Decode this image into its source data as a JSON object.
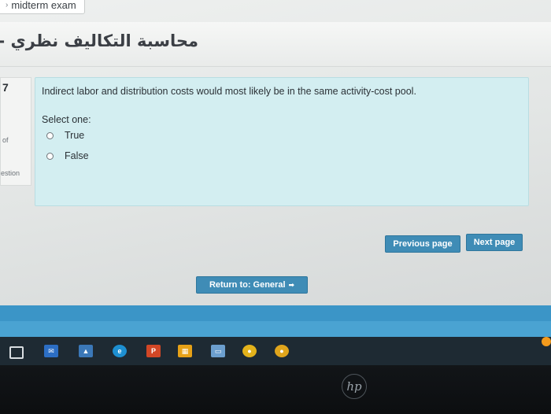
{
  "breadcrumb": {
    "label": "midterm exam"
  },
  "course": {
    "title": "محاسبة التكاليف نظري -"
  },
  "question_info": {
    "number": "7",
    "of_text": "of",
    "flag_text": "estion"
  },
  "question": {
    "text": "Indirect labor and distribution costs would most likely be in the same activity-cost pool.",
    "select_label": "Select one:",
    "options": [
      {
        "label": "True"
      },
      {
        "label": "False"
      }
    ]
  },
  "navigation": {
    "previous_label": "Previous page",
    "next_label": "Next page",
    "return_label": "Return to: General"
  },
  "taskbar": {
    "icons": [
      "task-view-icon",
      "mail-icon",
      "photos-icon",
      "edge-icon",
      "powerpoint-icon",
      "calculator-icon",
      "image-viewer-icon",
      "chrome-icon",
      "chrome-icon"
    ]
  },
  "colors": {
    "accent": "#3f8cb6",
    "question_bg": "#d3eef1",
    "taskbar": "#1e2a33"
  }
}
